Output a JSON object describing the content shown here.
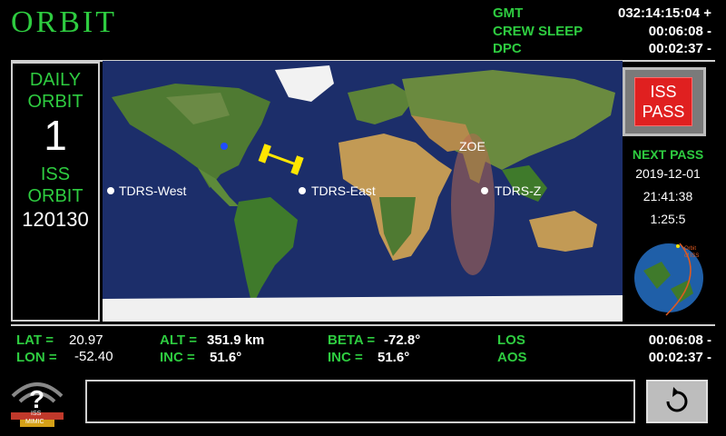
{
  "app_title": "ORBIT",
  "header": {
    "gmt_label": "GMT",
    "gmt_value": "032:14:15:04 +",
    "crew_sleep_label": "CREW SLEEP",
    "crew_sleep_value": "00:06:08 -",
    "dpc_label": "DPC",
    "dpc_value": "00:02:37 -"
  },
  "left_panel": {
    "daily_orbit_label_1": "DAILY",
    "daily_orbit_label_2": "ORBIT",
    "daily_orbit_value": "1",
    "iss_orbit_label_1": "ISS",
    "iss_orbit_label_2": "ORBIT",
    "iss_orbit_value": "120130"
  },
  "map": {
    "tdrs_west": "TDRS-West",
    "tdrs_east": "TDRS-East",
    "tdrs_z": "TDRS-Z",
    "zoe": "ZOE"
  },
  "right_panel": {
    "iss_pass_line1": "ISS",
    "iss_pass_line2": "PASS",
    "next_pass_label": "NEXT PASS",
    "next_pass_date": "2019-12-01",
    "next_pass_time": "21:41:38",
    "next_pass_duration": "1:25:5",
    "globe_caption_1": "Orbit",
    "globe_caption_2": "of ISS"
  },
  "telemetry": {
    "lat_label": "LAT =",
    "lat_value": "20.97",
    "lon_label": "LON =",
    "lon_value": "-52.40",
    "alt_label": "ALT =",
    "alt_value": "351.9 km",
    "inc1_label": "INC =",
    "inc1_value": "51.6°",
    "beta_label": "BETA =",
    "beta_value": "-72.8°",
    "inc2_label": "INC =",
    "inc2_value": "51.6°",
    "los_label": "LOS",
    "los_value": "00:06:08 -",
    "aos_label": "AOS",
    "aos_value": "00:02:37 -"
  },
  "logo": {
    "glyph": "?",
    "text_1": "ISS",
    "text_2": "MIMIC"
  },
  "message_box": "",
  "colors": {
    "accent_green": "#2ecc40",
    "pass_red": "#e02020",
    "map_ocean": "#1c2e6a",
    "iss_yellow": "#ffe600"
  }
}
